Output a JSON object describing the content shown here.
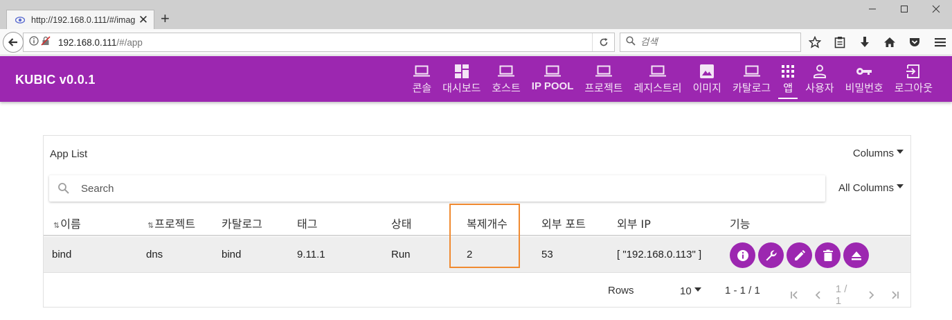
{
  "browser": {
    "tab_title": "http://192.168.0.111/#/imag",
    "url_host": "192.168.0.111",
    "url_path": "/#/app",
    "search_placeholder": "검색"
  },
  "app": {
    "brand": "KUBIC v0.0.1",
    "accent_color": "#9c27b0",
    "menu": [
      {
        "label": "콘솔",
        "icon": "laptop-icon"
      },
      {
        "label": "대시보드",
        "icon": "dashboard-icon"
      },
      {
        "label": "호스트",
        "icon": "laptop-icon"
      },
      {
        "label": "IP POOL",
        "icon": "laptop-icon"
      },
      {
        "label": "프로젝트",
        "icon": "laptop-icon"
      },
      {
        "label": "레지스트리",
        "icon": "laptop-icon"
      },
      {
        "label": "이미지",
        "icon": "image-icon"
      },
      {
        "label": "카탈로그",
        "icon": "laptop-icon"
      },
      {
        "label": "앱",
        "icon": "apps-grid-icon",
        "active": true
      },
      {
        "label": "사용자",
        "icon": "person-icon"
      },
      {
        "label": "비밀번호",
        "icon": "key-icon"
      },
      {
        "label": "로그아웃",
        "icon": "logout-icon"
      }
    ]
  },
  "list": {
    "title": "App List",
    "columns_label": "Columns",
    "search_placeholder": "Search",
    "all_columns_label": "All Columns",
    "headers": [
      "이름",
      "프로젝트",
      "카탈로그",
      "태그",
      "상태",
      "복제개수",
      "외부 포트",
      "외부 IP",
      "기능"
    ],
    "rows": [
      {
        "name": "bind",
        "project": "dns",
        "catalog": "bind",
        "tag": "9.11.1",
        "status": "Run",
        "replicas": "2",
        "ext_port": "53",
        "ext_ip": "[ \"192.168.0.113\" ]"
      }
    ],
    "row_actions": [
      "info-icon",
      "wrench-icon",
      "edit-icon",
      "delete-icon",
      "eject-icon"
    ],
    "footer": {
      "rows_label": "Rows",
      "rows_per_page": "10",
      "range": "1 - 1 / 1",
      "page": "1 / 1"
    }
  }
}
